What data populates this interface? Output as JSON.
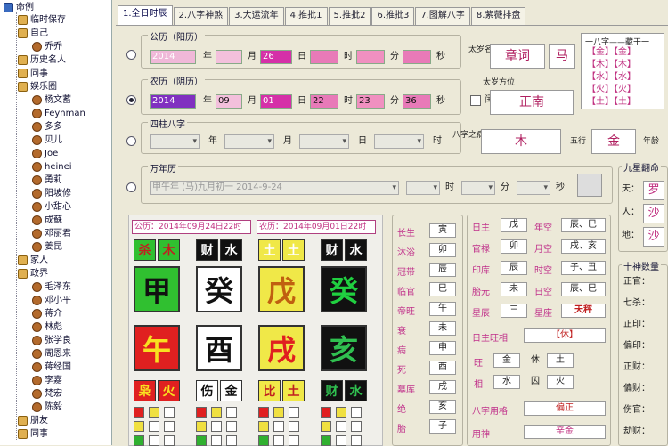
{
  "tree": {
    "root": "命例",
    "nodes": [
      {
        "label": "临时保存",
        "kind": "grp"
      },
      {
        "label": "自己",
        "kind": "grp"
      },
      {
        "label": "乔乔",
        "kind": "p"
      },
      {
        "label": "历史名人",
        "kind": "grp"
      },
      {
        "label": "同事",
        "kind": "grp"
      },
      {
        "label": "娱乐圈",
        "kind": "grp"
      },
      {
        "label": "杨文蓄",
        "kind": "p"
      },
      {
        "label": "Feynman",
        "kind": "p"
      },
      {
        "label": "多多",
        "kind": "p"
      },
      {
        "label": "贝儿",
        "kind": "p"
      },
      {
        "label": "Joe",
        "kind": "p"
      },
      {
        "label": "heinei",
        "kind": "p"
      },
      {
        "label": "勇莉",
        "kind": "p"
      },
      {
        "label": "阳坡修",
        "kind": "p"
      },
      {
        "label": "小甜心",
        "kind": "p"
      },
      {
        "label": "成蘇",
        "kind": "p"
      },
      {
        "label": "邓丽君",
        "kind": "p"
      },
      {
        "label": "姜昆",
        "kind": "p"
      },
      {
        "label": "家人",
        "kind": "grp"
      },
      {
        "label": "政界",
        "kind": "grp"
      },
      {
        "label": "毛泽东",
        "kind": "p"
      },
      {
        "label": "邓小平",
        "kind": "p"
      },
      {
        "label": "蒋介",
        "kind": "p"
      },
      {
        "label": "林彪",
        "kind": "p"
      },
      {
        "label": "张学良",
        "kind": "p"
      },
      {
        "label": "周恩来",
        "kind": "p"
      },
      {
        "label": "蒋经国",
        "kind": "p"
      },
      {
        "label": "李嘉",
        "kind": "p"
      },
      {
        "label": "梵宏",
        "kind": "p"
      },
      {
        "label": "陈毅",
        "kind": "p"
      },
      {
        "label": "朋友",
        "kind": "grp"
      },
      {
        "label": "同事",
        "kind": "grp"
      }
    ]
  },
  "tabs": [
    "1.全日时辰",
    "2.八字神煞",
    "3.大运流年",
    "4.推批1",
    "5.推批2",
    "6.推批3",
    "7.图解八字",
    "8.紫薇排盘"
  ],
  "solar": {
    "title": "公历（阳历）",
    "year": "2014",
    "month": "",
    "day": "26",
    "hour": "",
    "minute": "",
    "second": "",
    "u_year": "年",
    "u_month": "月",
    "u_day": "日",
    "u_hour": "时",
    "u_minute": "分",
    "u_second": "秒"
  },
  "lunar": {
    "title": "农历（阴历）",
    "year": "2014",
    "month": "09",
    "day": "01",
    "hour": "22",
    "minute": "23",
    "second": "36",
    "leap": "闰月"
  },
  "pillars_section": {
    "title": "四柱八字",
    "u": [
      "年",
      "月",
      "日",
      "时"
    ]
  },
  "wnl": {
    "title": "万年历",
    "value": "甲午年 (马)九月初一 2014-9-24",
    "u_hour": "时",
    "u_minute": "分",
    "u_second": "秒"
  },
  "side": {
    "taisui_label": "太岁名称",
    "taisui": "章词",
    "mark": "马",
    "fangwei_label": "太岁方位",
    "fangwei": "正南",
    "nayin_label": "八字之病",
    "nayin": "木",
    "wuxing_label": "五行",
    "wuxing": "金",
    "nianling_label": "年龄"
  },
  "legend": {
    "header": "一八字——藏干一",
    "rows": [
      "【金】【金】",
      "【木】【木】",
      "【水】【水】",
      "【火】【火】",
      "【土】【土】"
    ]
  },
  "jiugong": {
    "title": "九星翻命",
    "labels": [
      "天：",
      "人：",
      "地："
    ],
    "values": [
      "罗",
      "沙",
      "沙"
    ]
  },
  "chart": {
    "left_header": "公历：2014年09月24日22时",
    "right_header": "农历：2014年09月01日22时",
    "top_small": [
      [
        "杀",
        "木"
      ],
      [
        "财",
        "水"
      ],
      [
        "土",
        "土"
      ],
      [
        "财",
        "水"
      ]
    ],
    "stems": [
      "甲",
      "癸",
      "戊",
      "癸"
    ],
    "branches": [
      "午",
      "酉",
      "戌",
      "亥"
    ],
    "bottom_small": [
      [
        "枭",
        "火"
      ],
      [
        "伤",
        "金"
      ],
      [
        "比",
        "土"
      ],
      [
        "财",
        "水"
      ]
    ]
  },
  "shensha": {
    "labels": [
      "长生",
      "沐浴",
      "冠带",
      "临官",
      "帝旺",
      "衰",
      "病",
      "死",
      "墓库",
      "绝",
      "胎"
    ],
    "values": [
      "寅",
      "卯",
      "辰",
      "巳",
      "午",
      "未",
      "申",
      "酉",
      "戌",
      "亥",
      "子"
    ]
  },
  "mid": {
    "rows": [
      {
        "l1": "日主",
        "v1": "戊",
        "l2": "年空",
        "v2": "辰、巳"
      },
      {
        "l1": "官禄",
        "v1": "卯",
        "l2": "月空",
        "v2": "戌、亥"
      },
      {
        "l1": "印库",
        "v1": "辰",
        "l2": "时空",
        "v2": "子、丑"
      },
      {
        "l1": "胎元",
        "v1": "未",
        "l2": "日空",
        "v2": "辰、巳"
      },
      {
        "l1": "星辰",
        "v1": "三",
        "l2": "星座",
        "v2": "天秤"
      }
    ],
    "wangxiang_label": "日主旺相",
    "wangxiang": "【休】",
    "wx_rows": [
      {
        "a": "旺",
        "b": "金",
        "c": "休",
        "d": "土"
      },
      {
        "a": "相",
        "b": "水",
        "c": "囚",
        "d": "火"
      }
    ],
    "geju_label": "八字用格",
    "geju": "偏正",
    "yongshen_label": "用神",
    "yongshen": "辛金"
  },
  "shishen": {
    "title": "十神数量",
    "labels": [
      "正官：",
      "七杀：",
      "正印：",
      "偏印：",
      "正财：",
      "偏财：",
      "伤官：",
      "劫财："
    ]
  }
}
